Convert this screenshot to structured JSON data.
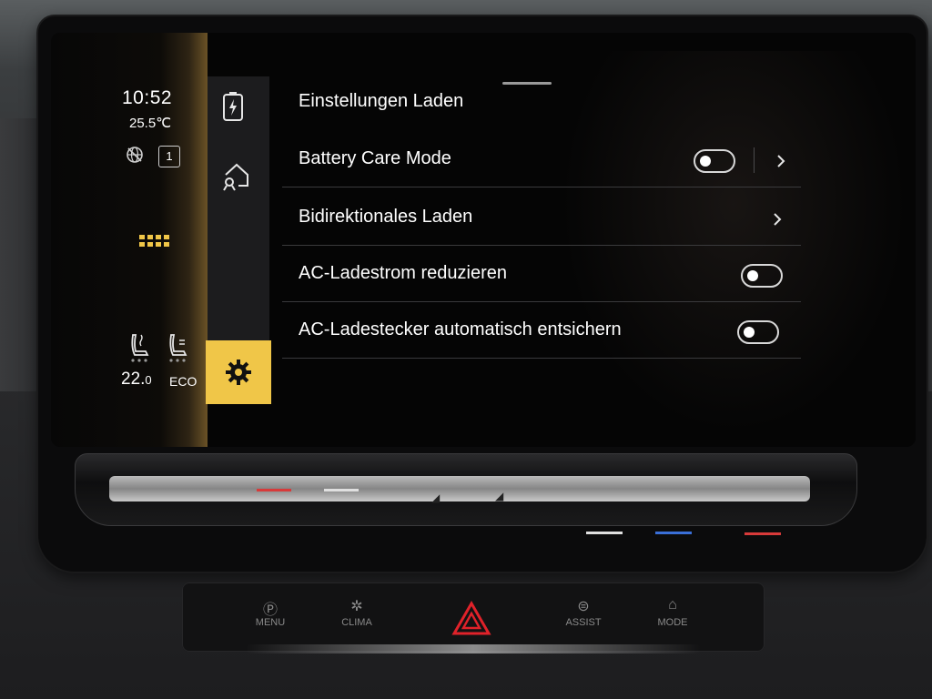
{
  "status": {
    "time": "10:52",
    "outside_temp": "25.5℃",
    "message_count": "1",
    "cabin_temp_main": "22.",
    "cabin_temp_decimal": "0",
    "climate_mode": "ECO"
  },
  "nav": {
    "items": [
      {
        "icon": "battery-charge-icon",
        "active": false
      },
      {
        "icon": "home-charging-icon",
        "active": false
      },
      {
        "icon": "gear-icon",
        "active": true
      }
    ]
  },
  "settings": {
    "title": "Einstellungen Laden",
    "rows": [
      {
        "label": "Battery Care Mode",
        "toggle": false,
        "has_submenu": true
      },
      {
        "label": "Bidirektionales Laden",
        "toggle": null,
        "has_submenu": true
      },
      {
        "label": "AC-Ladestrom reduzieren",
        "toggle": false,
        "has_submenu": false
      },
      {
        "label": "AC-Ladestecker automatisch entsichern",
        "toggle": false,
        "has_submenu": false
      }
    ]
  },
  "physical_buttons": {
    "menu": "MENU",
    "clima": "CLIMA",
    "assist": "ASSIST",
    "mode": "MODE"
  },
  "colors": {
    "accent": "#f0c648",
    "hazard": "#e0222a",
    "slider_blue": "#3a6fd8",
    "slider_red": "#d83a3a"
  }
}
